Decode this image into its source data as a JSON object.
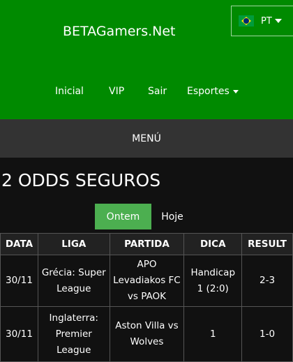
{
  "header": {
    "brand": "BETAGamers.Net",
    "language": {
      "label": "PT",
      "flag": "brazil-flag-icon"
    },
    "nav": [
      {
        "label": "Inicial"
      },
      {
        "label": "VIP"
      },
      {
        "label": "Sair"
      },
      {
        "label": "Esportes"
      }
    ]
  },
  "menu_label": "MENÚ",
  "page_title": "2 ODDS SEGUROS",
  "tabs": [
    {
      "label": "Ontem",
      "active": true
    },
    {
      "label": "Hoje",
      "active": false
    }
  ],
  "table": {
    "columns": [
      "DATA",
      "LIGA",
      "PARTIDA",
      "DICA",
      "RESULT"
    ],
    "rows": [
      {
        "data": "30/11",
        "liga": "Grécia: Super League",
        "partida": "APO Levadiakos FC vs PAOK",
        "dica": "Handicap 1 (2:0)",
        "result": "2-3"
      },
      {
        "data": "30/11",
        "liga": "Inglaterra: Premier League",
        "partida": "Aston Villa vs Wolves",
        "dica": "1",
        "result": "1-0"
      }
    ]
  },
  "colors": {
    "header_bg": "#008a00",
    "menubar_bg": "#333333",
    "page_bg": "#111111",
    "active_tab": "#4caf50"
  }
}
